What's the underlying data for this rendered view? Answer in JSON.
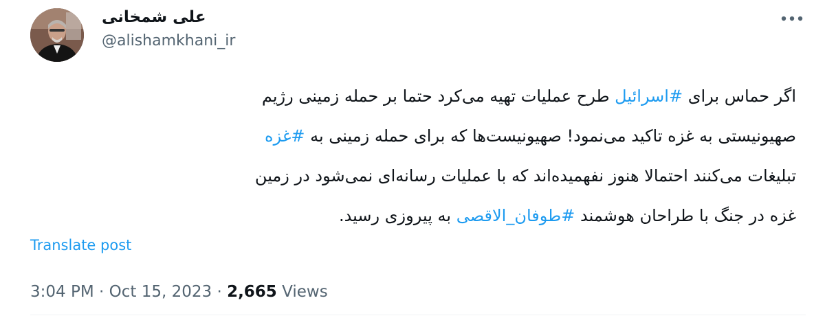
{
  "author": {
    "name": "علی شمخانی",
    "handle": "@alishamkhani_ir"
  },
  "tweet": {
    "lines": [
      [
        "اگر حماس برای ",
        {
          "hashtag": "#اسرائیل"
        },
        " طرح عملیات تهیه می‌کرد حتما بر حمله زمینی رژیم"
      ],
      [
        "صهیونیستی به غزه تاکید می‌نمود!  صهیونیست‌ها که برای حمله زمینی به ",
        {
          "hashtag": "#غزه"
        }
      ],
      [
        "تبلیغات می‌کنند احتمالا هنوز نفهمیده‌اند که با عملیات رسانه‌ای نمی‌شود در زمین"
      ],
      [
        "غزه در جنگ با طراحان هوشمند ",
        {
          "hashtag": "#طوفان_الاقصی"
        },
        " به پیروزی  رسید."
      ]
    ],
    "translate_label": "Translate post",
    "time": "3:04 PM",
    "separator": "·",
    "date": "Oct 15, 2023",
    "views_count": "2,665",
    "views_label": "Views"
  },
  "colors": {
    "hashtag": "#1d9bf0",
    "secondary_text": "#536471",
    "primary_text": "#0f1419"
  },
  "icons": {
    "more": "more-dots-icon",
    "avatar": "avatar-photo"
  }
}
